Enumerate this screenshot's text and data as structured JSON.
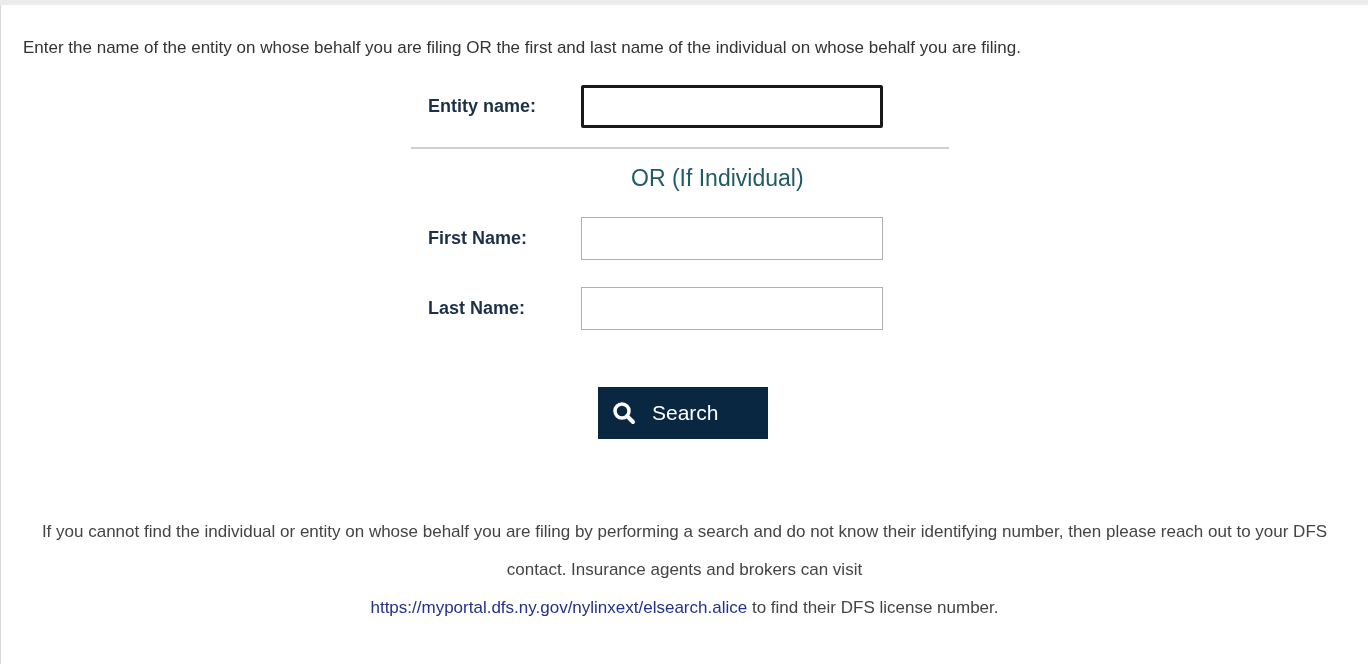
{
  "intro": "Enter the name of the entity on whose behalf you are filing OR the first and last name of the individual on whose behalf you are filing.",
  "entity_field": {
    "label": "Entity name:",
    "focused": true
  },
  "separator": "OR (If Individual)",
  "fields": [
    {
      "label": "First Name:",
      "focused": false
    },
    {
      "label": "Last Name:",
      "focused": false
    }
  ],
  "search_button": "Search",
  "footer": {
    "text_before": "If you cannot find the individual or entity on whose behalf you are filing by performing a search and do not know their identifying number, then please reach out to your DFS contact. Insurance agents and brokers can visit",
    "link": "https://myportal.dfs.ny.gov/nylinxext/elsearch.alice",
    "text_after": "to find their DFS license number."
  }
}
